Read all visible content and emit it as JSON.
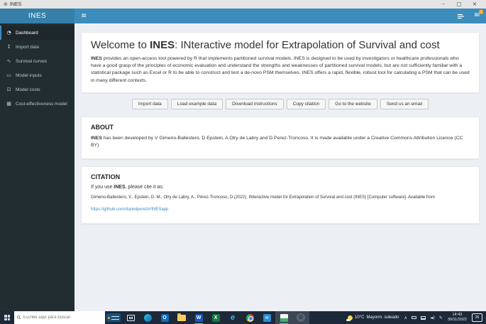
{
  "colors": {
    "header": "#3c8dbc",
    "logo_bg": "#367fa9",
    "sidebar_bg": "#222d32",
    "sidebar_active_bg": "#1e282c",
    "content_bg": "#ecf0f5",
    "link": "#3c8dbc",
    "badge_orange": "#f39c12",
    "taskbar_bg": "#1d2838"
  },
  "icons": {
    "globe": "⊕",
    "minimize": "–",
    "maximize": "□",
    "close": "×",
    "hamburger": "≡",
    "envelope": "✉",
    "chevron_up": "∧",
    "pen": "✎",
    "speaker": "◄)",
    "globe_app": "⊕"
  },
  "window": {
    "title": "INES"
  },
  "header": {
    "logo": "INES",
    "mail_badge": "1"
  },
  "sidebar": {
    "items": [
      {
        "label": "Dashboard",
        "icon": "dashboard-icon",
        "glyph": "◔",
        "active": true
      },
      {
        "label": "Import data",
        "icon": "import-icon",
        "glyph": "↧",
        "active": false
      },
      {
        "label": "Survival curves",
        "icon": "line-chart-icon",
        "glyph": "∿",
        "active": false
      },
      {
        "label": "Model inputs",
        "icon": "keyboard-icon",
        "glyph": "▭",
        "active": false
      },
      {
        "label": "Model costs",
        "icon": "money-bill-icon",
        "glyph": "⊡",
        "active": false
      },
      {
        "label": "Cost-effectiveness model",
        "icon": "calculator-icon",
        "glyph": "▦",
        "active": false
      }
    ]
  },
  "main": {
    "welcome": {
      "title_prefix": "Welcome to ",
      "title_brand": "INES",
      "title_suffix": ": INteractive model for Extrapolation of Survival and cost",
      "body_brand": "INES",
      "body_text": " provides an open-access tool powered by R that implements partitioned survival models. INES is designed to be used by investigators or healthcare professionals who have a good grasp of the principles of economic evaluation and understand the strengths and weaknesses of partitioned survival models, but are not sufficiently familiar with a statistical package such as Excel or R to be able to construct and test a de-novo PSM themselves. INES offers a rapid, flexible, robust tool for calculating a PSM that can be used in many different contexts."
    },
    "buttons": [
      "Import data",
      "Load example data",
      "Download instructions",
      "Copy citation",
      "Go to the website",
      "Send us an email"
    ],
    "about": {
      "heading": "ABOUT",
      "brand": "INES",
      "text": " has been developed by V Gimeno-Ballestero, D Epstein, A Olry de Labry and D Perez-Troncoso. It is made available under a Creative Commons Attribution Licence (CC BY)"
    },
    "citation": {
      "heading": "CITATION",
      "intro_prefix": "If you use ",
      "intro_brand": "INES",
      "intro_suffix": ", please cite it as:",
      "text": "Gimeno-Ballestero, V., Epstein, D. M., Olry de Labry, A., Pérez-Troncoso, D.(2022). INteractive model for Extrapolation of Survival and cost (INES) [Computer software]. Available from",
      "link": "https://github.com/danielpereztr/INESapp"
    }
  },
  "taskbar": {
    "search_placeholder": "Escribe aquí para buscar.",
    "weather_temp": "10°C",
    "weather_desc": "Mayorm. soleado",
    "time": "14:43",
    "date": "30/11/2022",
    "notification_count": "26"
  }
}
